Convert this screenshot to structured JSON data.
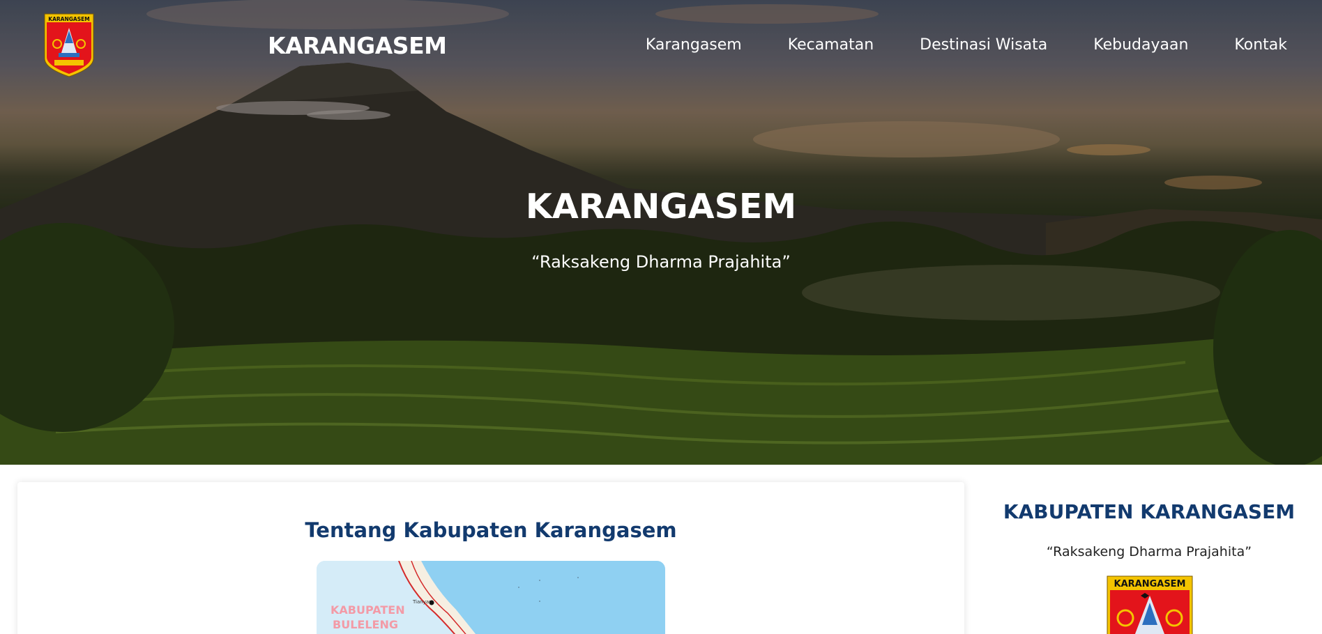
{
  "header": {
    "logo_icon": "karangasem-coat-of-arms",
    "logo_text": "KARANGASEM",
    "site_title": "KARANGASEM",
    "nav": [
      "Karangasem",
      "Kecamatan",
      "Destinasi Wisata",
      "Kebudayaan",
      "Kontak"
    ]
  },
  "hero": {
    "title": "KARANGASEM",
    "motto": "“Raksakeng Dharma Prajahita”"
  },
  "main": {
    "title": "Tentang Kabupaten Karangasem",
    "map": {
      "region_label_1": "KABUPATEN",
      "region_label_2": "BULELENG",
      "town": "Tianyar"
    }
  },
  "sidebar": {
    "title": "KABUPATEN KARANGASEM",
    "motto": "“Raksakeng Dharma Prajahita”",
    "logo_icon": "karangasem-coat-of-arms",
    "logo_text": "KARANGASEM"
  },
  "colors": {
    "heading_blue": "#123a6e",
    "shield_red": "#e3141b",
    "shield_gold": "#f4c400"
  }
}
